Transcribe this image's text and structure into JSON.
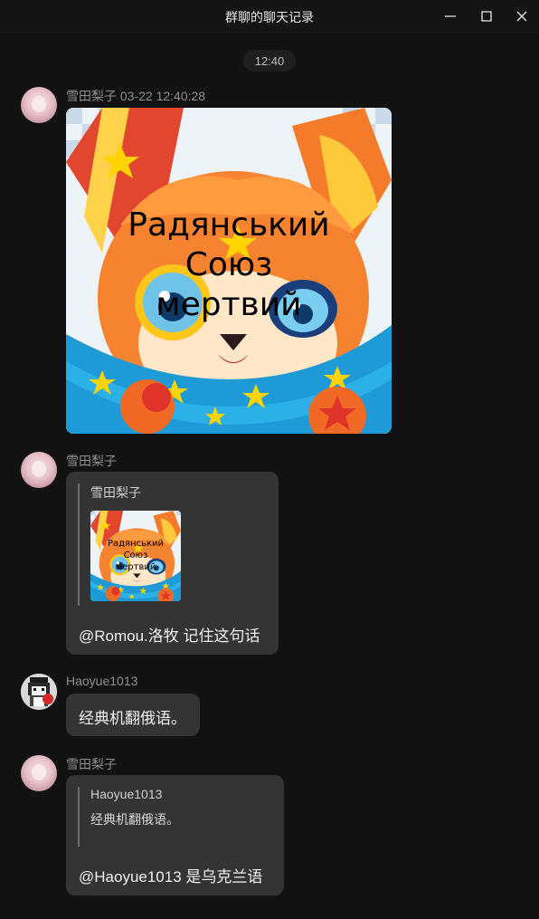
{
  "window": {
    "title": "群聊的聊天记录",
    "controls": {
      "minimize": "minimize-icon",
      "maximize": "maximize-icon",
      "close": "close-icon"
    }
  },
  "timestamp_divider": "12:40",
  "messages": [
    {
      "sender": "雪田梨子 03-22 12:40:28",
      "avatar": "pink-haired-girl-avatar",
      "image": {
        "description_icon": "orange-fox-cartoon-image",
        "overlay_lines": [
          "Радянський",
          "Союз",
          "мертвий"
        ]
      }
    },
    {
      "sender": "雪田梨子",
      "avatar": "pink-haired-girl-avatar",
      "quote": {
        "name": "雪田梨子",
        "thumb_lines": [
          "Радянський",
          "Союз",
          "мертвий"
        ]
      },
      "text": "@Romou.洛牧 记住这句话"
    },
    {
      "sender": "Haoyue1013",
      "avatar": "pixel-character-avatar",
      "text": "经典机翻俄语。"
    },
    {
      "sender": "雪田梨子",
      "avatar": "pink-haired-girl-avatar",
      "quote": {
        "name": "Haoyue1013",
        "text": "经典机翻俄语。"
      },
      "text": "@Haoyue1013 是乌克兰语"
    }
  ]
}
